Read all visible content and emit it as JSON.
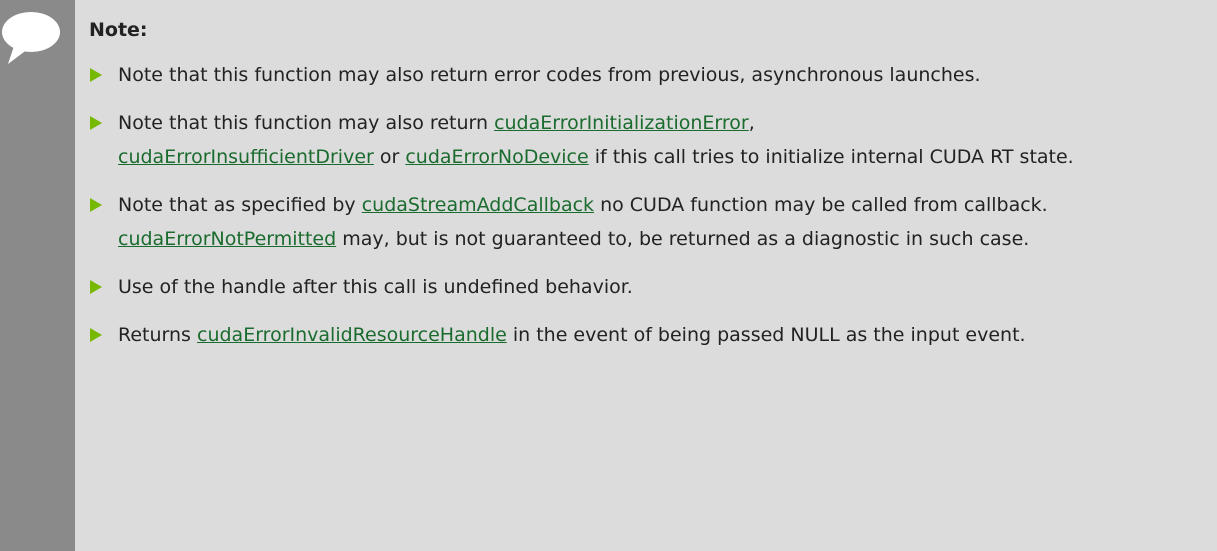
{
  "note": {
    "heading": "Note:",
    "accent_color": "#76b900",
    "link_color": "#1a6b2e",
    "items": [
      {
        "t0": "Note that this function may also return error codes from previous, asynchronous launches."
      },
      {
        "t0": "Note that this function may also return ",
        "l0": "cudaErrorInitializationError",
        "t1": ", ",
        "l1": "cudaErrorInsufficientDriver",
        "t2": " or ",
        "l2": "cudaErrorNoDevice",
        "t3": " if this call tries to initialize internal CUDA RT state."
      },
      {
        "t0": "Note that as specified by ",
        "l0": "cudaStreamAddCallback",
        "t1": " no CUDA function may be called from callback. ",
        "l1": "cudaErrorNotPermitted",
        "t2": " may, but is not guaranteed to, be returned as a diagnostic in such case."
      },
      {
        "t0": "Use of the handle after this call is undefined behavior."
      },
      {
        "t0": "Returns ",
        "l0": "cudaErrorInvalidResourceHandle",
        "t1": " in the event of being passed NULL as the input event."
      }
    ]
  }
}
